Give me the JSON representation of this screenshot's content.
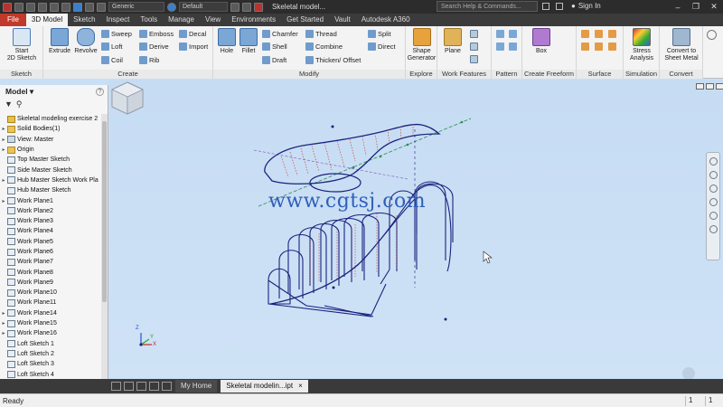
{
  "titlebar": {
    "material": "Generic",
    "appearance": "Default",
    "doc_title": "Skeletal model...",
    "search_placeholder": "Search Help & Commands...",
    "signin": "Sign In"
  },
  "tabs": [
    "File",
    "3D Model",
    "Sketch",
    "Inspect",
    "Tools",
    "Manage",
    "View",
    "Environments",
    "Get Started",
    "Vault",
    "Autodesk A360"
  ],
  "ribbon": {
    "sketch": {
      "label": "Sketch",
      "start_line1": "Start",
      "start_line2": "2D Sketch"
    },
    "create": {
      "label": "Create",
      "extrude": "Extrude",
      "revolve": "Revolve",
      "sweep": "Sweep",
      "loft": "Loft",
      "coil": "Coil",
      "emboss": "Emboss",
      "derive": "Derive",
      "rib": "Rib",
      "decal": "Decal",
      "import": "Import"
    },
    "modify": {
      "label": "Modify",
      "hole": "Hole",
      "fillet": "Fillet",
      "chamfer": "Chamfer",
      "shell": "Shell",
      "draft": "Draft",
      "thread": "Thread",
      "combine": "Combine",
      "thicken": "Thicken/ Offset",
      "split": "Split",
      "direct": "Direct"
    },
    "explore": {
      "label": "Explore",
      "shape_line1": "Shape",
      "shape_line2": "Generator"
    },
    "work_features": {
      "label": "Work Features",
      "plane": "Plane"
    },
    "pattern": {
      "label": "Pattern"
    },
    "freeform": {
      "label": "Create Freeform",
      "box": "Box"
    },
    "surface": {
      "label": "Surface"
    },
    "simulation": {
      "label": "Simulation",
      "stress_line1": "Stress",
      "stress_line2": "Analysis"
    },
    "convert": {
      "label": "Convert",
      "line1": "Convert to",
      "line2": "Sheet Metal"
    }
  },
  "browser": {
    "title": "Model",
    "help": "?",
    "nodes": [
      {
        "label": "Skeletal modeling exercise 2",
        "icon": "part-icon",
        "exp": ""
      },
      {
        "label": "Solid Bodies(1)",
        "icon": "folder-icon",
        "exp": "▸"
      },
      {
        "label": "View: Master",
        "icon": "view-icon",
        "exp": "▸"
      },
      {
        "label": "Origin",
        "icon": "folder-icon",
        "exp": "▸"
      },
      {
        "label": "Top Master Sketch",
        "icon": "sketch-icon",
        "exp": ""
      },
      {
        "label": "Side Master Sketch",
        "icon": "sketch-icon",
        "exp": ""
      },
      {
        "label": "Hub Master Sketch Work Pla",
        "icon": "sketch-icon",
        "exp": "▸"
      },
      {
        "label": "Hub Master Sketch",
        "icon": "sketch-icon",
        "exp": ""
      },
      {
        "label": "Work Plane1",
        "icon": "plane-icon",
        "exp": "▸"
      },
      {
        "label": "Work Plane2",
        "icon": "plane-icon",
        "exp": ""
      },
      {
        "label": "Work Plane3",
        "icon": "plane-icon",
        "exp": ""
      },
      {
        "label": "Work Plane4",
        "icon": "plane-icon",
        "exp": ""
      },
      {
        "label": "Work Plane5",
        "icon": "plane-icon",
        "exp": ""
      },
      {
        "label": "Work Plane6",
        "icon": "plane-icon",
        "exp": ""
      },
      {
        "label": "Work Plane7",
        "icon": "plane-icon",
        "exp": ""
      },
      {
        "label": "Work Plane8",
        "icon": "plane-icon",
        "exp": ""
      },
      {
        "label": "Work Plane9",
        "icon": "plane-icon",
        "exp": ""
      },
      {
        "label": "Work Plane10",
        "icon": "plane-icon",
        "exp": ""
      },
      {
        "label": "Work Plane11",
        "icon": "plane-icon",
        "exp": ""
      },
      {
        "label": "Work Plane14",
        "icon": "plane-icon",
        "exp": "▸"
      },
      {
        "label": "Work Plane15",
        "icon": "plane-icon",
        "exp": "▸"
      },
      {
        "label": "Work Plane16",
        "icon": "plane-icon",
        "exp": "▸"
      },
      {
        "label": "Loft Sketch 1",
        "icon": "sketch-icon",
        "exp": ""
      },
      {
        "label": "Loft Sketch 2",
        "icon": "sketch-icon",
        "exp": ""
      },
      {
        "label": "Loft Sketch 3",
        "icon": "sketch-icon",
        "exp": ""
      },
      {
        "label": "Loft Sketch 4",
        "icon": "sketch-icon",
        "exp": ""
      }
    ]
  },
  "viewport": {
    "watermark": "www.cgtsj.com",
    "axis_labels": {
      "x": "X",
      "y": "Y",
      "z": "Z"
    }
  },
  "doctabs": {
    "home": "My Home",
    "active": "Skeletal modelin...ipt",
    "close": "×"
  },
  "status": {
    "text": "Ready",
    "count1": "1",
    "count2": "1"
  }
}
